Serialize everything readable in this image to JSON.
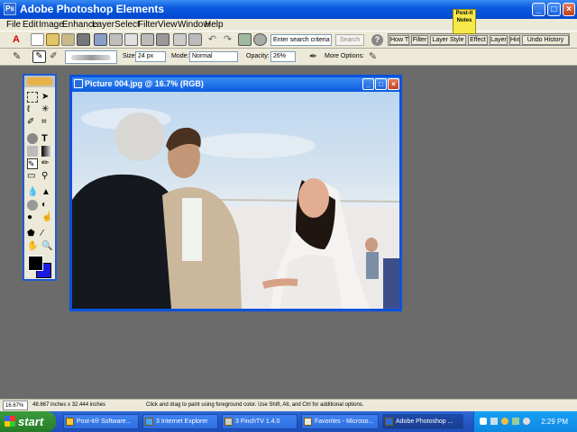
{
  "window": {
    "title": "Adobe Photoshop Elements"
  },
  "menu": [
    "File",
    "Edit",
    "Image",
    "Enhance",
    "Layer",
    "Select",
    "Filter",
    "View",
    "Window",
    "Help"
  ],
  "toolbar": {
    "search_placeholder": "Enter search criteria",
    "search_button": "Search"
  },
  "palette_well": [
    "How T",
    "Filter",
    "Layer Style",
    "Effect",
    "Layer",
    "Hin",
    "Undo History"
  ],
  "postit": {
    "line1": "Post-it",
    "line2": "Notes"
  },
  "options": {
    "size_label": "Size:",
    "size_value": "24 px",
    "mode_label": "Mode:",
    "mode_value": "Normal",
    "opacity_label": "Opacity:",
    "opacity_value": "26%",
    "more_options": "More Options:"
  },
  "document": {
    "title": "Picture 004.jpg @ 16.7% (RGB)"
  },
  "status": {
    "zoom": "16.67%",
    "dimensions": "48.667 inches x 32.444 inches",
    "hint": "Click and drag to paint using foreground color. Use Shift, Alt, and Ctrl for additional options."
  },
  "taskbar": {
    "start": "start",
    "tasks": [
      "Post-it® Software...",
      "3 Internet Explorer",
      "3 FinchTV 1.4.0",
      "Favorites - Microso...",
      "Adobe Photoshop ..."
    ],
    "clock": "2:29 PM"
  },
  "colors": {
    "foreground": "#000000",
    "background": "#1c1ae0"
  }
}
